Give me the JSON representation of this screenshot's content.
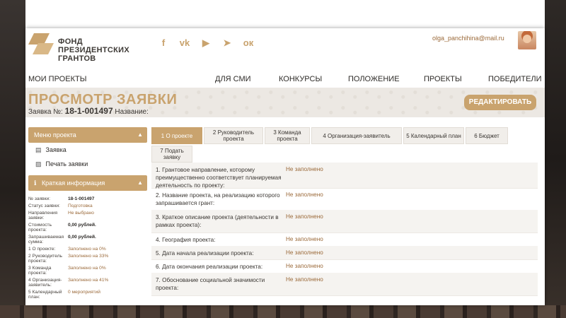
{
  "header": {
    "logo_lines": [
      "ФОНД",
      "ПРЕЗИДЕНТСКИХ",
      "ГРАНТОВ"
    ],
    "social_icons": [
      "facebook-icon",
      "vk-icon",
      "youtube-icon",
      "telegram-icon",
      "odnoklassniki-icon"
    ],
    "social_glyphs": [
      "f",
      "vk",
      "▶",
      "➤",
      "ок"
    ],
    "email": "olga_panchihina@mail.ru"
  },
  "nav": {
    "my_projects": "МОИ ПРОЕКТЫ",
    "items": [
      "ДЛЯ СМИ",
      "КОНКУРСЫ",
      "ПОЛОЖЕНИЕ",
      "ПРОЕКТЫ",
      "ПОБЕДИТЕЛИ"
    ]
  },
  "banner": {
    "title": "ПРОСМОТР ЗАЯВКИ",
    "application_label": "Заявка №:",
    "application_number": "18-1-001497",
    "name_label": "Название:",
    "edit_button": "РЕДАКТИРОВАТЬ"
  },
  "sidebar": {
    "menu_title": "Меню проекта",
    "menu_items": [
      "Заявка",
      "Печать заявки"
    ],
    "info_title": "Краткая информация",
    "info": [
      {
        "k": "№ заявки:",
        "v": "18-1-001497"
      },
      {
        "k": "Статус заявки:",
        "v": "Подготовка"
      },
      {
        "k": "Направления заявки:",
        "v": "Не выбрано"
      },
      {
        "k": "Стоимость проекта:",
        "v": "0,00 рублей."
      },
      {
        "k": "Запрашиваемая сумма:",
        "v": "0,00 рублей."
      },
      {
        "k": "1 О проекте:",
        "v": "Заполнено на 0%"
      },
      {
        "k": "2 Руководитель проекта:",
        "v": "Заполнено на 33%"
      },
      {
        "k": "3 Команда проекта:",
        "v": "Заполнено на 0%"
      },
      {
        "k": "4 Организация-заявитель:",
        "v": "Заполнено на 41%"
      },
      {
        "k": "5 Календарный план:",
        "v": "0 мероприятий"
      }
    ]
  },
  "tabs": [
    "1 О проекте",
    "2 Руководитель проекта",
    "3 Команда проекта",
    "4 Организация-заявитель",
    "5 Календарный план",
    "6 Бюджет",
    "7 Подать заявку"
  ],
  "fields": [
    {
      "q": "1. Грантовое направление, которому преимущественно соответствует планируемая деятельность по проекту:",
      "a": "Не заполнено"
    },
    {
      "q": "2. Название проекта, на реализацию которого запрашивается грант:",
      "a": "Не заполнено"
    },
    {
      "q": "3. Краткое описание проекта (деятельности в рамках проекта):",
      "a": "Не заполнено"
    },
    {
      "q": "4. География проекта:",
      "a": "Не заполнено"
    },
    {
      "q": "5. Дата начала реализации проекта:",
      "a": "Не заполнено"
    },
    {
      "q": "6. Дата окончания реализации проекта:",
      "a": "Не заполнено"
    },
    {
      "q": "7. Обоснование социальной значимости проекта:",
      "a": "Не заполнено"
    }
  ],
  "colors": {
    "accent": "#c9a36e",
    "link": "#9b6a3a"
  }
}
